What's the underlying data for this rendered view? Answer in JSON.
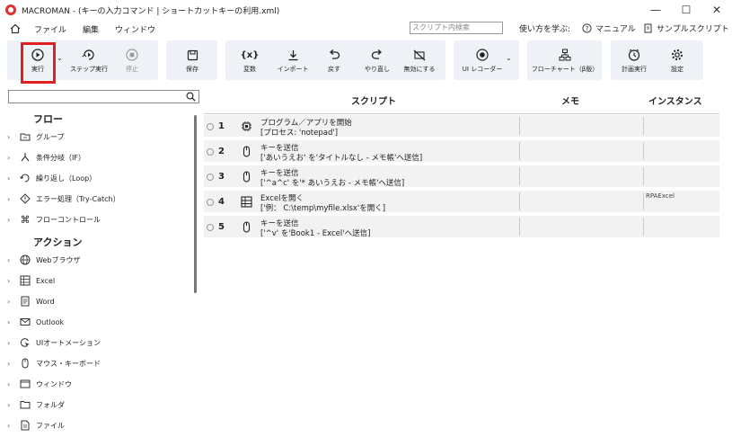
{
  "window": {
    "title": "MACROMAN - (キーの入力コマンド | ショートカットキーの利用.xml)",
    "minimize": "—",
    "maximize": "☐",
    "close": "✕"
  },
  "menu": {
    "items": [
      "ファイル",
      "編集",
      "ウィンドウ"
    ],
    "search_placeholder": "スクリプト内検索",
    "learn": "使い方を学ぶ:",
    "manual": "マニュアル",
    "samples": "サンプルスクリプト"
  },
  "toolbar": {
    "run": "実行",
    "step_run": "ステップ実行",
    "stop": "停止",
    "save": "保存",
    "variable": "変数",
    "import": "インポート",
    "undo": "戻す",
    "redo": "やり直し",
    "disable": "無効にする",
    "ui_recorder": "UI レコーダー",
    "flowchart": "フローチャート（β版）",
    "schedule": "計画実行",
    "settings": "設定"
  },
  "left_panel": {
    "flow_title": "フロー",
    "flow_items": [
      "グループ",
      "条件分岐（IF）",
      "繰り返し（Loop）",
      "エラー処理（Try-Catch）",
      "フローコントロール"
    ],
    "action_title": "アクション",
    "action_items": [
      "Webブラウザ",
      "Excel",
      "Word",
      "Outlook",
      "UIオートメーション",
      "マウス・キーボード",
      "ウィンドウ",
      "フォルダ",
      "ファイル"
    ]
  },
  "table": {
    "headers": {
      "script": "スクリプト",
      "memo": "メモ",
      "instance": "インスタンス"
    },
    "rows": [
      {
        "num": "1",
        "icon": "chip-icon",
        "line1": "プログラム／アプリを開始",
        "line2": "[プロセス: 'notepad']",
        "instance": ""
      },
      {
        "num": "2",
        "icon": "mouse-icon",
        "line1": "キーを送信",
        "line2": "['あいうえお' を'タイトルなし - メモ帳'へ送信]",
        "instance": ""
      },
      {
        "num": "3",
        "icon": "mouse-icon",
        "line1": "キーを送信",
        "line2": "['^a^c' を'* あいうえお - メモ帳'へ送信]",
        "instance": ""
      },
      {
        "num": "4",
        "icon": "excel-icon",
        "line1": "Excelを開く",
        "line2": "['例： C:\\temp\\myfile.xlsx'を開く]",
        "instance": "RPAExcel"
      },
      {
        "num": "5",
        "icon": "mouse-icon",
        "line1": "キーを送信",
        "line2": "['^v' を'Book1 - Excel'へ送信]",
        "instance": ""
      }
    ]
  },
  "colors": {
    "highlight": "#e02020",
    "toolbar_bg": "#eef1f6",
    "row_bg": "#f2f2f2"
  }
}
